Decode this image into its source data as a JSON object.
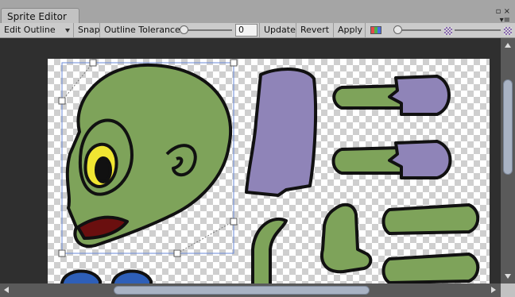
{
  "window": {
    "tab_title": "Sprite Editor"
  },
  "toolbar": {
    "mode_dropdown": "Edit Outline",
    "snap_label": "Snap",
    "tolerance_label": "Outline Tolerance",
    "tolerance_value": "0",
    "update_label": "Update",
    "revert_label": "Revert",
    "apply_label": "Apply"
  },
  "icons": {
    "color_channels": "rgb-channels-icon",
    "alpha_small": "checker-small-icon",
    "alpha_large": "checker-large-icon"
  },
  "colors": {
    "selection_outline": "#6a8ad8",
    "sprite_green": "#7ea35a",
    "sprite_purple": "#8f84b8",
    "sprite_blue": "#2e5fb8"
  }
}
